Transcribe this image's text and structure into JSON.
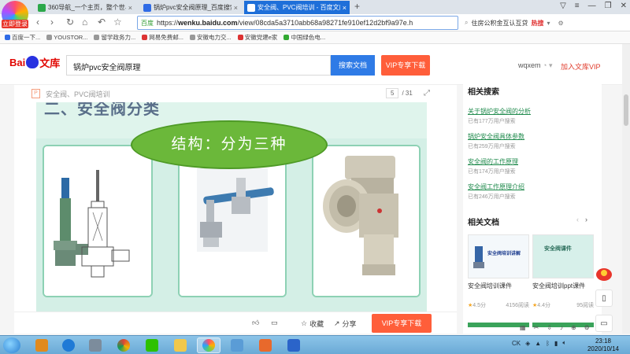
{
  "browser": {
    "login_badge": "立即登录",
    "tabs": [
      {
        "label": "360导航_一个主页，整个世界",
        "active": false
      },
      {
        "label": "锅炉pvc安全阀原理_百度搜索",
        "active": false
      },
      {
        "label": "安全阀、PVC阀培训 - 百度文库",
        "active": true
      }
    ],
    "tab_close": "×",
    "new_tab": "+",
    "address": {
      "safe_tag": "百度",
      "url_prefix": "https://",
      "url_domain": "wenku.baidu.com",
      "url_path": "/view/08cda5a3710abb68a98271fe910ef12d2bf9a97e.h"
    },
    "search_box": {
      "text": "住房公积金互认互贷",
      "hot": "热搜"
    },
    "bookmarks": [
      "百度一下...",
      "YOUSTOR...",
      "留学政务力...",
      "网易免费邮...",
      "安徽电力交...",
      "安徽党建e家",
      "中国绿色电..."
    ]
  },
  "wenku": {
    "logo_text_1": "Bai",
    "logo_text_2": "文库",
    "search_value": "锅炉pvc安全阀原理",
    "search_button": "搜索文档",
    "vip_button": "VIP专享下载",
    "username": "wqxem",
    "join_vip": "加入文库VIP",
    "doc": {
      "title": "安全阀、PVC阀培训",
      "page_current": "5",
      "page_total": "/ 31",
      "slide_heading": "二、安全阀分类",
      "slide_ellipse": "结构：分为三种"
    },
    "toolbar": {
      "collect": "收藏",
      "share": "分享",
      "vip_download": "VIP专享下载"
    },
    "related_search": {
      "heading": "相关搜索",
      "items": [
        {
          "label": "关于锅炉安全阀的分析",
          "count": "已有177万用户搜索"
        },
        {
          "label": "锅炉安全阀具体参数",
          "count": "已有259万用户搜索"
        },
        {
          "label": "安全阀的工作原理",
          "count": "已有174万用户搜索"
        },
        {
          "label": "安全阀工作原理介绍",
          "count": "已有246万用户搜索"
        }
      ]
    },
    "related_docs": {
      "heading": "相关文档",
      "items": [
        {
          "title": "安全阀培训课件",
          "thumb_text": "安全阀培训讲解",
          "rating": "4.5分",
          "views": "4156阅读"
        },
        {
          "title": "安全阀培训ppt课件",
          "thumb_text": "安全阀课件",
          "rating": "4.4分",
          "views": "95阅读"
        }
      ]
    }
  },
  "taskbar": {
    "tray_lang": "CK",
    "time": "23:18",
    "date": "2020/10/14"
  },
  "colors": {
    "accent_blue": "#2f7be6",
    "vip_orange": "#ff5e3a",
    "slide_green": "#6bb83a",
    "link_green": "#1f8a4c"
  }
}
